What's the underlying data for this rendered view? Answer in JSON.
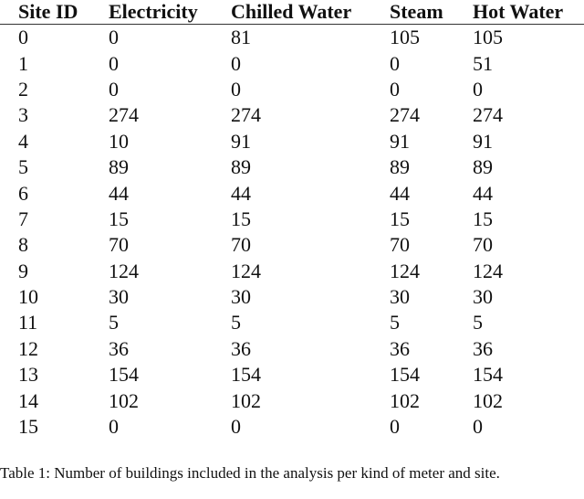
{
  "table": {
    "headers": [
      "Site ID",
      "Electricity",
      "Chilled Water",
      "Steam",
      "Hot Water"
    ],
    "rows": [
      [
        "0",
        "0",
        "81",
        "105",
        "105"
      ],
      [
        "1",
        "0",
        "0",
        "0",
        "51"
      ],
      [
        "2",
        "0",
        "0",
        "0",
        "0"
      ],
      [
        "3",
        "274",
        "274",
        "274",
        "274"
      ],
      [
        "4",
        "10",
        "91",
        "91",
        "91"
      ],
      [
        "5",
        "89",
        "89",
        "89",
        "89"
      ],
      [
        "6",
        "44",
        "44",
        "44",
        "44"
      ],
      [
        "7",
        "15",
        "15",
        "15",
        "15"
      ],
      [
        "8",
        "70",
        "70",
        "70",
        "70"
      ],
      [
        "9",
        "124",
        "124",
        "124",
        "124"
      ],
      [
        "10",
        "30",
        "30",
        "30",
        "30"
      ],
      [
        "11",
        "5",
        "5",
        "5",
        "5"
      ],
      [
        "12",
        "36",
        "36",
        "36",
        "36"
      ],
      [
        "13",
        "154",
        "154",
        "154",
        "154"
      ],
      [
        "14",
        "102",
        "102",
        "102",
        "102"
      ],
      [
        "15",
        "0",
        "0",
        "0",
        "0"
      ]
    ]
  },
  "caption": "Table 1:  Number of buildings included in the analysis per kind of meter and site."
}
